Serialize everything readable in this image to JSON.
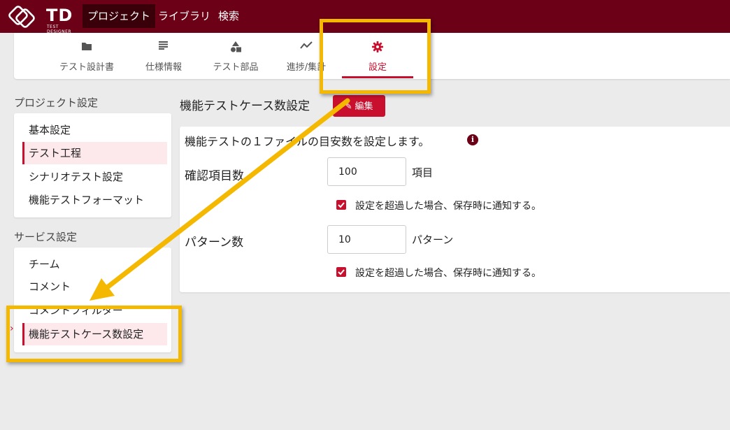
{
  "header": {
    "logo_text": "TD",
    "logo_sub": "TEST DESIGNER",
    "nav": [
      {
        "label": "プロジェクト",
        "active": true
      },
      {
        "label": "ライブラリ",
        "active": false
      },
      {
        "label": "検索",
        "active": false
      }
    ]
  },
  "tabs": [
    {
      "label": "テスト設計書",
      "icon": "folder-icon"
    },
    {
      "label": "仕様情報",
      "icon": "list-icon"
    },
    {
      "label": "テスト部品",
      "icon": "shapes-icon"
    },
    {
      "label": "進捗/集計",
      "icon": "trend-icon"
    },
    {
      "label": "設定",
      "icon": "gear-icon",
      "active": true
    }
  ],
  "sidebar": {
    "project_title": "プロジェクト設定",
    "project_items": [
      {
        "label": "基本設定"
      },
      {
        "label": "テスト工程",
        "selected": true
      },
      {
        "label": "シナリオテスト設定"
      },
      {
        "label": "機能テストフォーマット"
      }
    ],
    "service_title": "サービス設定",
    "service_items": [
      {
        "label": "チーム"
      },
      {
        "label": "コメント"
      },
      {
        "label": "コメントフィルター"
      },
      {
        "label": "機能テストケース数設定",
        "selected": true
      }
    ]
  },
  "main": {
    "title": "機能テストケース数設定",
    "edit_label": "編集",
    "description": "機能テストの１ファイルの目安数を設定します。",
    "info_icon": "i",
    "fields": [
      {
        "label": "確認項目数",
        "value": "100",
        "unit": "項目",
        "notify": "設定を超過した場合、保存時に通知する。",
        "checked": true
      },
      {
        "label": "パターン数",
        "value": "10",
        "unit": "パターン",
        "notify": "設定を超過した場合、保存時に通知する。",
        "checked": true
      }
    ]
  },
  "colors": {
    "brand": "#6b0016",
    "accent": "#c8102e",
    "annotation": "#f5b800"
  }
}
